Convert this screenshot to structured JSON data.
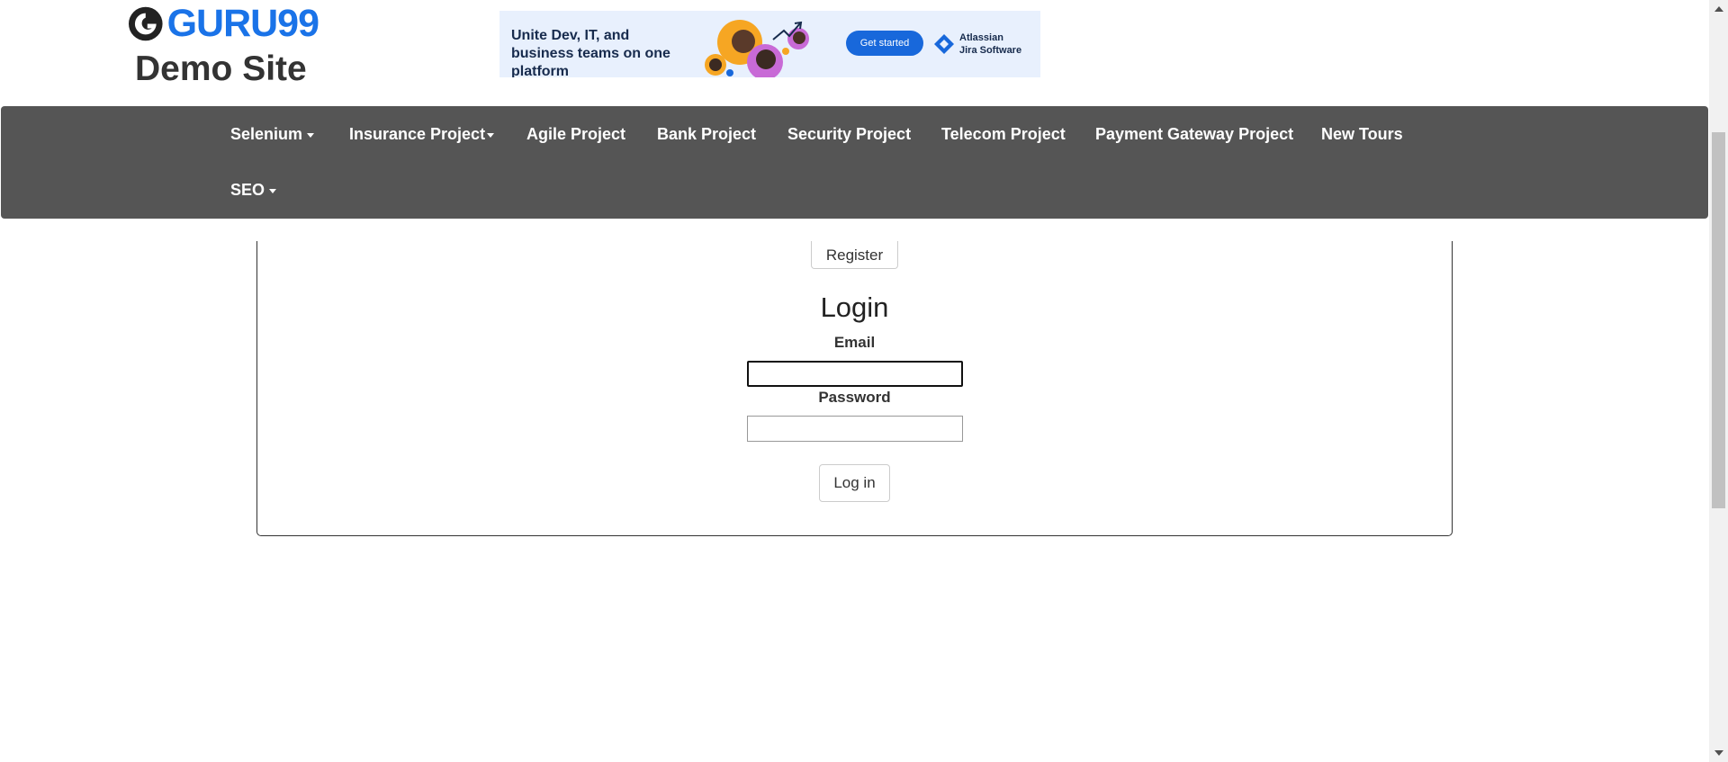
{
  "header": {
    "logo_text": "GURU99",
    "site_title": "Demo Site"
  },
  "ad": {
    "headline": "Unite Dev, IT, and business teams on one platform",
    "cta": "Get started",
    "brand_line1": "Atlassian",
    "brand_line2": "Jira Software",
    "brand_color": "#1868db"
  },
  "nav": {
    "items": [
      {
        "label": "Selenium",
        "dropdown": true
      },
      {
        "label": "Insurance Project",
        "dropdown": true
      },
      {
        "label": "Agile Project",
        "dropdown": false
      },
      {
        "label": "Bank Project",
        "dropdown": false
      },
      {
        "label": "Security Project",
        "dropdown": false
      },
      {
        "label": "Telecom Project",
        "dropdown": false
      },
      {
        "label": "Payment Gateway Project",
        "dropdown": false
      },
      {
        "label": "New Tours",
        "dropdown": false
      },
      {
        "label": "SEO",
        "dropdown": true
      }
    ],
    "background": "#555555"
  },
  "form": {
    "register_label": "Register",
    "title": "Login",
    "email_label": "Email",
    "email_value": "",
    "password_label": "Password",
    "password_value": "",
    "login_label": "Log in"
  }
}
